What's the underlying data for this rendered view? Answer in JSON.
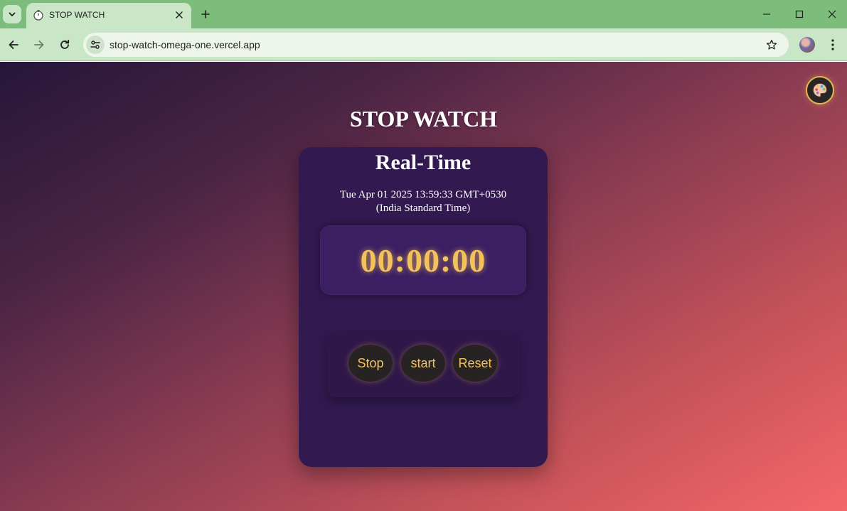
{
  "browser": {
    "tab": {
      "title": "STOP WATCH",
      "favicon": "stopwatch-icon"
    },
    "address_bar": {
      "url": "stop-watch-omega-one.vercel.app"
    },
    "colors": {
      "tabstrip": "#7dbd7b",
      "toolbar": "#c9e6c6"
    }
  },
  "page": {
    "title": "STOP WATCH",
    "theme_button_icon": "palette-icon",
    "card": {
      "heading": "Real-Time",
      "datetime_line1": "Tue Apr 01 2025 13:59:33 GMT+0530",
      "datetime_line2": "(India Standard Time)",
      "display": "00:00:00",
      "buttons": {
        "stop": "Stop",
        "start": "start",
        "reset": "Reset"
      }
    },
    "colors": {
      "accent": "#f3c35a",
      "card": "#321a50",
      "gradient_start": "#26163a",
      "gradient_end": "#f4676a"
    }
  }
}
